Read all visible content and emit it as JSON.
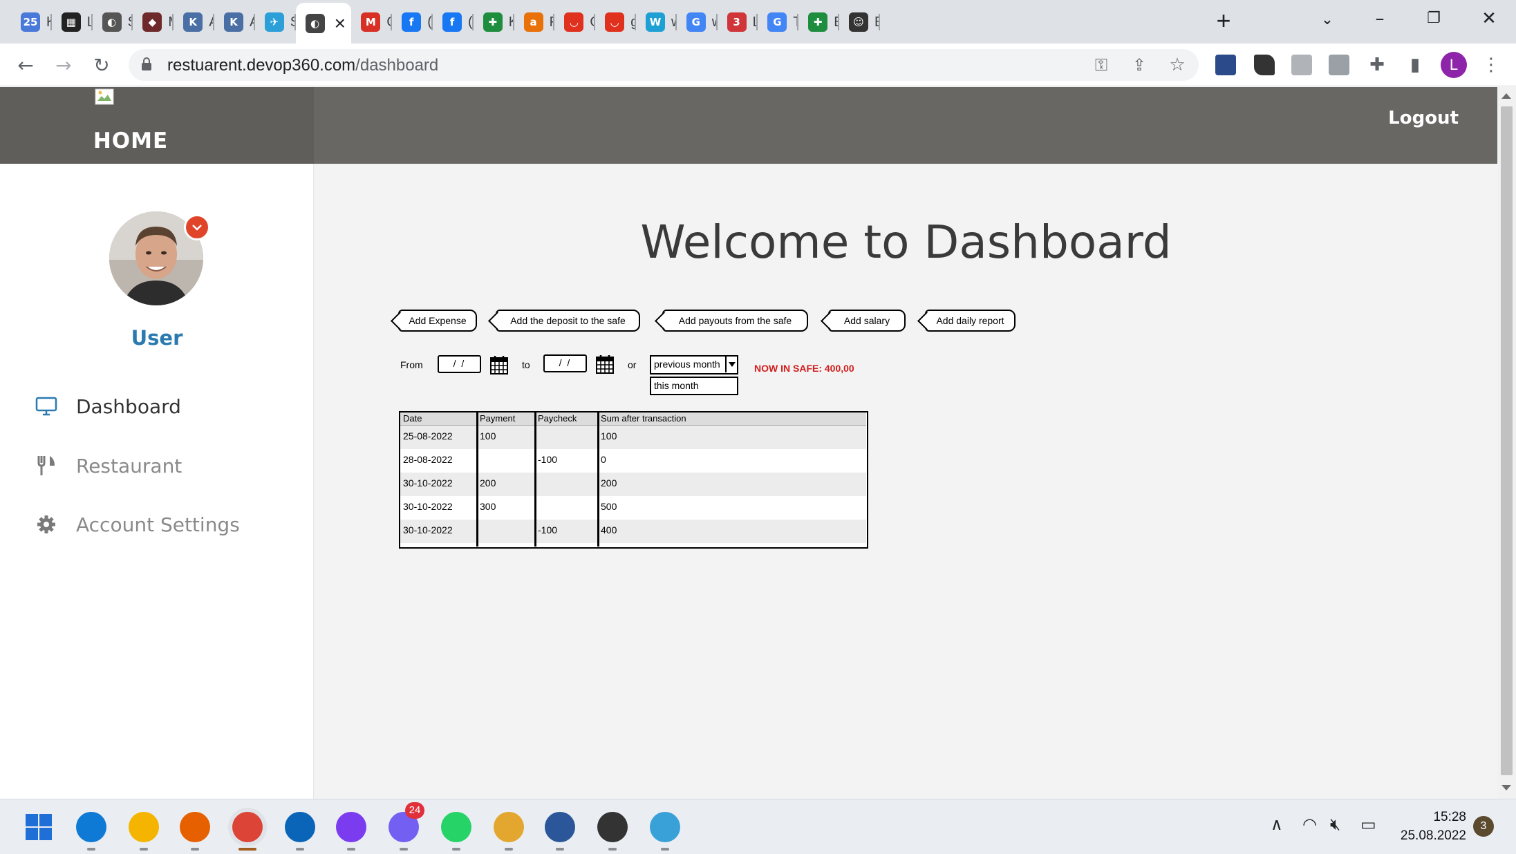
{
  "browser": {
    "tabs": [
      {
        "name": "tab-ki",
        "icon": "calendar-icon",
        "short": "K",
        "color": "#4a7ad9",
        "glyph": "25"
      },
      {
        "name": "tab-lo",
        "icon": "shop-icon",
        "short": "L",
        "color": "#222222",
        "glyph": "▦"
      },
      {
        "name": "tab-s",
        "icon": "globe-icon",
        "short": "S",
        "color": "#555555",
        "glyph": "◐"
      },
      {
        "name": "tab-m",
        "icon": "spy-icon",
        "short": "M",
        "color": "#6e2a2a",
        "glyph": "◆"
      },
      {
        "name": "tab-a1",
        "icon": "k-icon",
        "short": "A",
        "color": "#4a6fa5",
        "glyph": "K"
      },
      {
        "name": "tab-a2",
        "icon": "k-icon",
        "short": "A",
        "color": "#4a6fa5",
        "glyph": "K"
      },
      {
        "name": "tab-si",
        "icon": "bird-icon",
        "short": "S",
        "color": "#2d9fd8",
        "glyph": "✈"
      },
      {
        "name": "tab-active",
        "icon": "globe-icon",
        "short": "",
        "color": "#444444",
        "glyph": "◐"
      },
      {
        "name": "tab-gmail",
        "icon": "gmail-icon",
        "short": "O",
        "color": "#d93025",
        "glyph": "M"
      },
      {
        "name": "tab-fb1",
        "icon": "facebook-icon",
        "short": "(",
        "color": "#1877f2",
        "glyph": "f"
      },
      {
        "name": "tab-fb2",
        "icon": "facebook-icon",
        "short": "(",
        "color": "#1877f2",
        "glyph": "f"
      },
      {
        "name": "tab-k",
        "icon": "plus-sheet-icon",
        "short": "K",
        "color": "#1e8e3e",
        "glyph": "✚"
      },
      {
        "name": "tab-f",
        "icon": "a-icon",
        "short": "F",
        "color": "#e8710a",
        "glyph": "a"
      },
      {
        "name": "tab-o",
        "icon": "pocket-icon",
        "short": "O",
        "color": "#e0301e",
        "glyph": "◡"
      },
      {
        "name": "tab-g",
        "icon": "pocket-icon",
        "short": "g",
        "color": "#e0301e",
        "glyph": "◡"
      },
      {
        "name": "tab-w",
        "icon": "w-icon",
        "short": "w",
        "color": "#1ea0d4",
        "glyph": "W"
      },
      {
        "name": "tab-google",
        "icon": "google-icon",
        "short": "w",
        "color": "#4285f4",
        "glyph": "G"
      },
      {
        "name": "tab-l",
        "icon": "360-icon",
        "short": "L",
        "color": "#d0353a",
        "glyph": "3"
      },
      {
        "name": "tab-t",
        "icon": "translate-icon",
        "short": "T",
        "color": "#4285f4",
        "glyph": "G"
      },
      {
        "name": "tab-e",
        "icon": "plus-sheet-icon",
        "short": "E",
        "color": "#1e8e3e",
        "glyph": "✚"
      },
      {
        "name": "tab-ei",
        "icon": "smiley-icon",
        "short": "E",
        "color": "#333333",
        "glyph": "☺"
      }
    ],
    "url_domain": "restuarent.devop360.com",
    "url_path": "/dashboard",
    "profile_initial": "L"
  },
  "header": {
    "home_title": "HOME",
    "logout_label": "Logout"
  },
  "sidebar": {
    "user_name": "User",
    "items": [
      {
        "label": "Dashboard",
        "icon": "monitor-icon"
      },
      {
        "label": "Restaurant",
        "icon": "cutlery-icon"
      },
      {
        "label": "Account Settings",
        "icon": "gear-icon"
      }
    ]
  },
  "main": {
    "welcome": "Welcome to Dashboard",
    "actions": [
      "Add Expense",
      "Add the deposit to the safe",
      "Add payouts from the safe",
      "Add salary",
      "Add daily report"
    ],
    "filter": {
      "from_label": "From",
      "from_value": "/ /",
      "to_label": "to",
      "to_value": "/ /",
      "or_label": "or",
      "period_selected": "previous month",
      "period_option": "this month",
      "safe_text": "NOW IN SAFE: 400,00"
    },
    "table": {
      "columns": [
        "Date",
        "Payment",
        "Paycheck",
        "Sum after transaction"
      ],
      "rows": [
        [
          "25-08-2022",
          "100",
          "",
          "100"
        ],
        [
          "28-08-2022",
          "",
          "-100",
          "0"
        ],
        [
          "30-10-2022",
          "200",
          "",
          "200"
        ],
        [
          "30-10-2022",
          "300",
          "",
          "500"
        ],
        [
          "30-10-2022",
          "",
          "-100",
          "400"
        ]
      ]
    }
  },
  "taskbar": {
    "apps": [
      {
        "icon": "windows-start-icon",
        "color": "#1f6fd6"
      },
      {
        "icon": "edge-icon",
        "color": "#0f7ad6"
      },
      {
        "icon": "file-explorer-icon",
        "color": "#f4b400"
      },
      {
        "icon": "firefox-icon",
        "color": "#e66000"
      },
      {
        "icon": "chrome-icon",
        "color": "#db4437"
      },
      {
        "icon": "outlook-icon",
        "color": "#0a64b8"
      },
      {
        "icon": "messenger-icon",
        "color": "#7b3cf0"
      },
      {
        "icon": "viber-icon",
        "color": "#7360f2"
      },
      {
        "icon": "whatsapp-icon",
        "color": "#25d366"
      },
      {
        "icon": "money-bag-icon",
        "color": "#e3a72f"
      },
      {
        "icon": "word-icon",
        "color": "#2b579a"
      },
      {
        "icon": "smiley-icon",
        "color": "#333333"
      },
      {
        "icon": "paint-icon",
        "color": "#3aa0d8"
      }
    ],
    "viber_badge": "24",
    "time": "15:28",
    "date": "25.08.2022",
    "notifications": "3"
  }
}
